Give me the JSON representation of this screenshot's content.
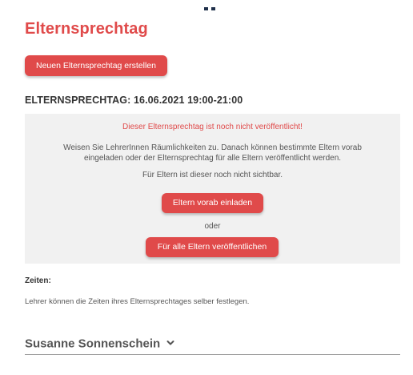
{
  "page": {
    "title": "Elternsprechtag",
    "create_button_label": "Neuen Elternsprechtag erstellen",
    "section_heading": "ELTERNSPRECHTAG: 16.06.2021 19:00-21:00"
  },
  "info_box": {
    "warning": "Dieser Elternsprechtag ist noch nicht veröffentlicht!",
    "instruction_line1": "Weisen Sie LehrerInnen Räumlichkeiten zu. Danach können bestimmte Eltern vorab",
    "instruction_line2": "eingeladen oder der Elternsprechtag für alle Eltern veröffentlicht werden.",
    "visibility_note": "Für Eltern ist dieser noch nicht sichtbar.",
    "invite_button_label": "Eltern vorab einladen",
    "or_text": "oder",
    "publish_button_label": "Für alle Eltern veröffentlichen"
  },
  "times": {
    "label": "Zeiten:",
    "description": "Lehrer können die Zeiten ihres Elternsprechtages selber festlegen."
  },
  "teacher": {
    "name": "Susanne Sonnenschein",
    "expand_icon": "chevron-down-icon"
  },
  "colors": {
    "accent": "#e04a4a",
    "box_background": "#f1f1f1",
    "text": "#333333",
    "header_mark": "#1f2f4a"
  }
}
